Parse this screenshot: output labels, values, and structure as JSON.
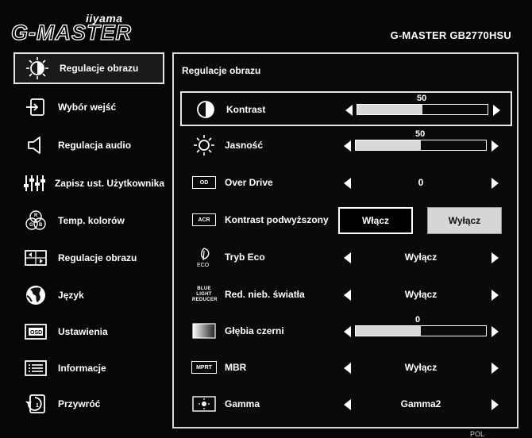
{
  "header": {
    "brand_small": "iiyama",
    "brand_big": "G-MASTER",
    "model": "G-MASTER GB2770HSU"
  },
  "sidebar": {
    "items": [
      {
        "label": "Regulacje obrazu",
        "icon": "contrast-sun-icon",
        "active": true
      },
      {
        "label": "Wybór wejść",
        "icon": "input-source-icon"
      },
      {
        "label": "Regulacja audio",
        "icon": "speaker-icon"
      },
      {
        "label": "Zapisz ust. Użytkownika",
        "icon": "sliders-icon"
      },
      {
        "label": "Temp. kolorów",
        "icon": "rgb-circles-icon"
      },
      {
        "label": "Regulacje obrazu",
        "icon": "picture-adjust-icon"
      },
      {
        "label": "Język",
        "icon": "globe-icon"
      },
      {
        "label": "Ustawienia",
        "icon": "osd-icon"
      },
      {
        "label": "Informacje",
        "icon": "info-list-icon"
      },
      {
        "label": "Przywróć",
        "icon": "reset-icon"
      }
    ]
  },
  "panel": {
    "title": "Regulacje obrazu",
    "rows": [
      {
        "label": "Kontrast",
        "icon": "contrast-icon",
        "kind": "bar",
        "value": "50",
        "level": 0.5
      },
      {
        "label": "Jasność",
        "icon": "brightness-icon",
        "kind": "bar",
        "value": "50",
        "level": 0.5
      },
      {
        "label": "Over Drive",
        "icon": "overdrive-icon",
        "icon_text": "OD",
        "kind": "select",
        "value": "0"
      },
      {
        "label": "Kontrast podwyższony",
        "icon": "acr-icon",
        "icon_text": "ACR",
        "kind": "toggle",
        "on_label": "Włącz",
        "off_label": "Wyłącz"
      },
      {
        "label": "Tryb Eco",
        "icon": "eco-leaf-icon",
        "icon_text": "ECO",
        "kind": "select",
        "value": "Wyłącz"
      },
      {
        "label": "Red. nieb. światła",
        "icon": "blue-light-icon",
        "icon_text": "BLUE LIGHT REDUCER",
        "kind": "select",
        "value": "Wyłącz"
      },
      {
        "label": "Głębia czerni",
        "icon": "black-level-icon",
        "kind": "bar",
        "value": "0",
        "level": 0.5
      },
      {
        "label": "MBR",
        "icon": "mprt-icon",
        "icon_text": "MPRT",
        "kind": "select",
        "value": "Wyłącz"
      },
      {
        "label": "Gamma",
        "icon": "gamma-icon",
        "kind": "select",
        "value": "Gamma2"
      }
    ]
  },
  "taskbar": {
    "lang": "POL"
  },
  "colors": {
    "background": "#060606",
    "text": "#ffffff",
    "bar_fill": "#d8d8d8",
    "button_off_bg": "#d6d6d6"
  }
}
